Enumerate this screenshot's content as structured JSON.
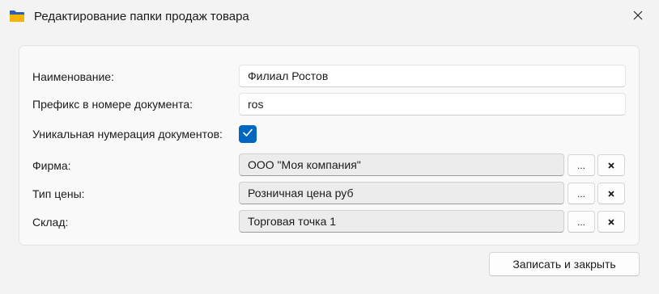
{
  "window": {
    "title": "Редактирование папки продаж товара",
    "icon": "folder-icon",
    "close_icon": "close-icon"
  },
  "form": {
    "name": {
      "label": "Наименование:",
      "value": "Филиал Ростов"
    },
    "prefix": {
      "label": "Префикс в номере документа:",
      "value": "ros"
    },
    "unique_numbering": {
      "label": "Уникальная нумерация документов:",
      "checked": true
    },
    "company": {
      "label": "Фирма:",
      "value": "ООО \"Моя компания\""
    },
    "price_type": {
      "label": "Тип цены:",
      "value": "Розничная цена руб"
    },
    "warehouse": {
      "label": "Склад:",
      "value": "Торговая точка 1"
    },
    "select_button_label": "...",
    "clear_button_label": "×"
  },
  "footer": {
    "save_close_label": "Записать и закрыть"
  },
  "colors": {
    "accent": "#0067c0",
    "folder_front": "#f5b400",
    "folder_back": "#2f5fb0"
  }
}
